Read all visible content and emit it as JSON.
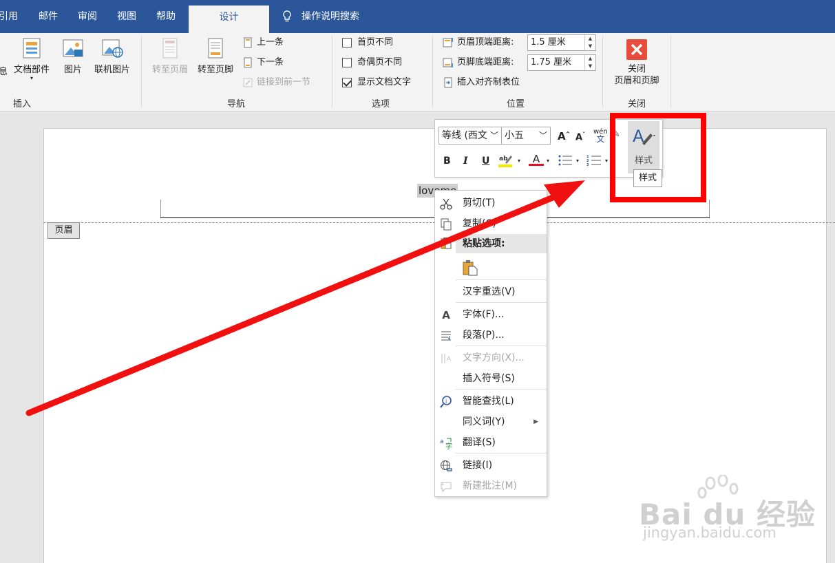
{
  "tabs": [
    {
      "label": "引用"
    },
    {
      "label": "邮件"
    },
    {
      "label": "审阅"
    },
    {
      "label": "视图"
    },
    {
      "label": "帮助"
    },
    {
      "label": "设计",
      "active": true
    }
  ],
  "tell_me": "操作说明搜索",
  "ribbon": {
    "insert": {
      "partial_label": "息",
      "doc_parts": "文档部件",
      "picture": "图片",
      "online_picture": "联机图片",
      "group": "插入"
    },
    "nav": {
      "goto_header": "转至页眉",
      "goto_footer": "转至页脚",
      "previous": "上一条",
      "next": "下一条",
      "link_previous": "链接到前一节",
      "group": "导航"
    },
    "options": {
      "diff_first": "首页不同",
      "diff_odd_even": "奇偶页不同",
      "show_doc_text": "显示文档文字",
      "show_doc_text_checked": true,
      "group": "选项"
    },
    "position": {
      "header_top_label": "页眉顶端距离:",
      "header_top_value": "1.5 厘米",
      "footer_bottom_label": "页脚底端距离:",
      "footer_bottom_value": "1.75 厘米",
      "insert_align_tab": "插入对齐制表位",
      "group": "位置"
    },
    "close": {
      "line1": "关闭",
      "line2": "页眉和页脚",
      "group": "关闭"
    }
  },
  "document": {
    "header_tag": "页眉",
    "header_text": "loveme"
  },
  "mini_toolbar": {
    "font_name": "等线 (西文",
    "font_size": "小五",
    "bold": "B",
    "italic": "I",
    "underline": "U",
    "styles_label": "样式",
    "tooltip": "样式",
    "accent_highlight": "#f5e800",
    "accent_font_color": "#e81123"
  },
  "context_menu": {
    "cut": "剪切(T)",
    "copy": "复制(C)",
    "paste_options": "粘贴选项:",
    "reconvert": "汉字重选(V)",
    "font": "字体(F)...",
    "paragraph": "段落(P)...",
    "text_direction": "文字方向(X)...",
    "insert_symbol": "插入符号(S)",
    "smart_lookup": "智能查找(L)",
    "synonyms": "同义词(Y)",
    "translate": "翻译(S)",
    "link": "链接(I)",
    "new_comment": "新建批注(M)"
  },
  "watermark": {
    "main": "Bai du 经验",
    "sub": "jingyan.baidu.com"
  },
  "colors": {
    "word_blue": "#2b579a",
    "annotation_red": "#ff0000",
    "close_red": "#e74c3c"
  }
}
